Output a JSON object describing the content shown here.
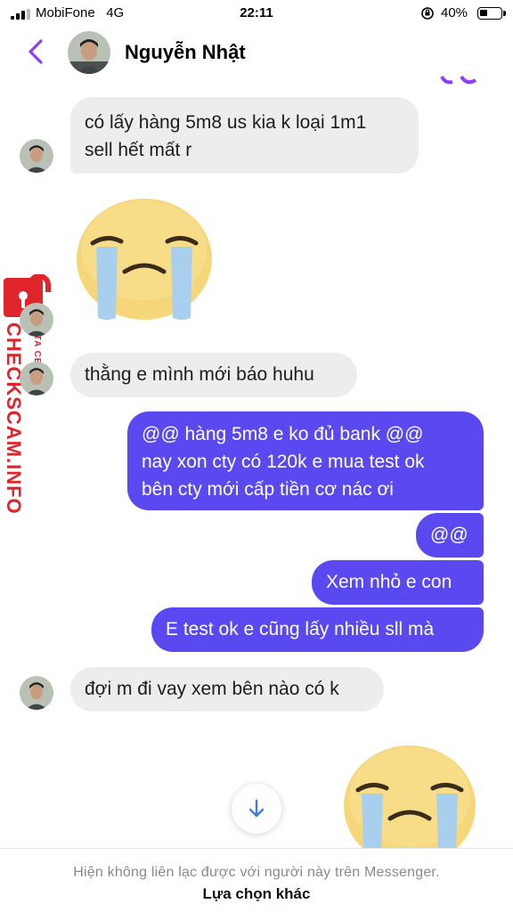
{
  "status_bar": {
    "carrier": "MobiFone",
    "network": "4G",
    "time": "22:11",
    "battery_percent": "40%",
    "battery_level": 0.4
  },
  "header": {
    "contact_name": "Nguyễn Nhật",
    "back_icon": "chevron-left-icon",
    "accent_color": "#8a3ffc"
  },
  "messages": [
    {
      "direction": "incoming",
      "lines": [
        "có lấy hàng 5m8 us kia k loại 1m1",
        "sell hết mất r"
      ]
    },
    {
      "direction": "incoming",
      "emoji": "crying-face-emoji"
    },
    {
      "direction": "incoming",
      "lines": [
        "thằng e mình mới báo huhu"
      ]
    },
    {
      "direction": "outgoing",
      "lines": [
        "@@ hàng 5m8 e ko đủ bank @@",
        "nay xon cty có 120k e mua test ok",
        "bên cty mới cấp tiền cơ nác ơi"
      ]
    },
    {
      "direction": "outgoing",
      "lines": [
        "@@"
      ]
    },
    {
      "direction": "outgoing",
      "lines": [
        "Xem nhỏ e con"
      ]
    },
    {
      "direction": "outgoing",
      "lines": [
        "E test ok e cũng lấy nhiều sll mà"
      ]
    },
    {
      "direction": "incoming",
      "lines": [
        "đợi m đi vay xem bên nào có k"
      ]
    },
    {
      "direction": "outgoing",
      "emoji": "crying-face-emoji"
    }
  ],
  "watermark": {
    "main": "CHECKSCAM.INFO",
    "sub": "DATA CENTER"
  },
  "footer": {
    "notice": "Hiện không liên lạc được với người này trên Messenger.",
    "action": "Lựa chọn khác"
  },
  "colors": {
    "outgoing_bubble": "#5a49f0",
    "incoming_bubble": "#ededed",
    "watermark": "#e0242b"
  }
}
